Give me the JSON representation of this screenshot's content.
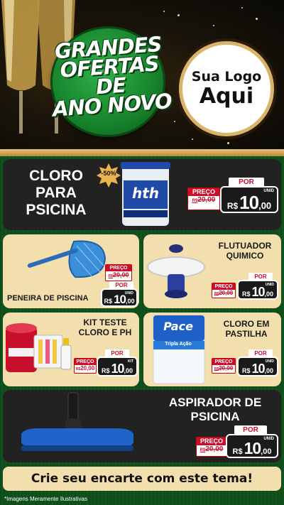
{
  "header": {
    "badge_lines": [
      "GRANDES",
      "OFERTAS DE",
      "ANO NOVO"
    ],
    "logo_line1": "Sua Logo",
    "logo_line2": "Aqui"
  },
  "products": {
    "cloro": {
      "title_lines": [
        "CLORO",
        "PARA",
        "PSICINA"
      ],
      "discount": "-50%",
      "brand": "hth",
      "preco_label": "PREÇO",
      "old_price": "20,00",
      "old_prefix": "R$",
      "por": "POR",
      "currency": "R$",
      "price_int": "10",
      "price_cents": ",00",
      "unit": "UNID"
    },
    "peneira": {
      "title": "PENEIRA DE PISCINA",
      "preco_label": "PREÇO",
      "old_price": "20,00",
      "old_prefix": "R$",
      "por": "POR",
      "currency": "R$",
      "price_int": "10",
      "price_cents": ",00",
      "unit": "UNID"
    },
    "flutuador": {
      "title_lines": [
        "FLUTUADOR",
        "QUIMICO"
      ],
      "preco_label": "PREÇO",
      "old_price": "20,00",
      "old_prefix": "R$",
      "por": "POR",
      "currency": "R$",
      "price_int": "10",
      "price_cents": ",00",
      "unit": "UNID"
    },
    "kit": {
      "title_lines": [
        "KIT TESTE",
        "CLORO E PH"
      ],
      "preco_label": "PREÇO",
      "old_price": "20,00",
      "old_prefix": "R$",
      "por": "POR",
      "currency": "R$",
      "price_int": "10",
      "price_cents": ",00",
      "unit": "KIT"
    },
    "pastilha": {
      "title_lines": [
        "CLORO EM",
        "PASTILHA"
      ],
      "brand": "Pace",
      "brand_sub": "Tripla Ação",
      "preco_label": "PREÇO",
      "old_price": "20,00",
      "old_prefix": "R$",
      "por": "POR",
      "currency": "R$",
      "price_int": "10",
      "price_cents": ",00",
      "unit": "UNID"
    },
    "aspirador": {
      "title_lines": [
        "ASPIRADOR DE",
        "PSICINA"
      ],
      "preco_label": "PREÇO",
      "old_price": "20,00",
      "old_prefix": "R$",
      "por": "POR",
      "currency": "R$",
      "price_int": "10",
      "price_cents": ",00",
      "unit": "UNID"
    }
  },
  "cta": "Crie seu encarte com este tema!",
  "footnote": "*Imagens Meramente Ilustrativas",
  "colors": {
    "accent_red": "#c8102e",
    "gold": "#e7c27b",
    "green": "#17832c",
    "dark_card": "#222222",
    "light_card": "#f3dfae"
  }
}
